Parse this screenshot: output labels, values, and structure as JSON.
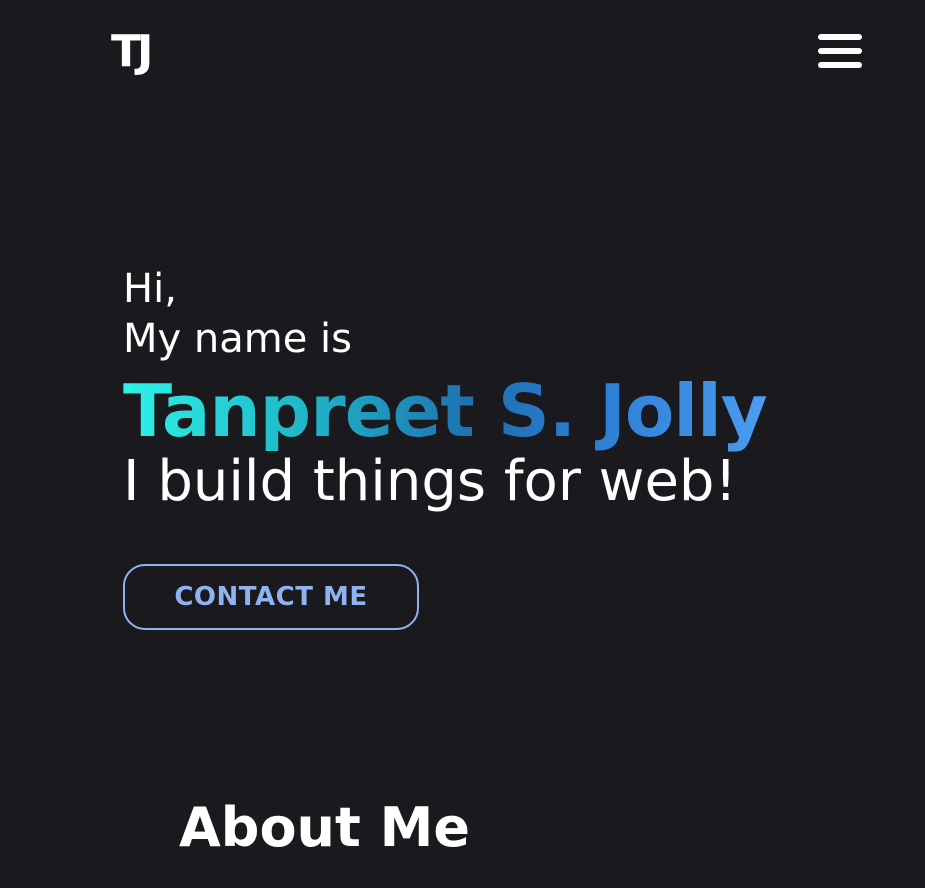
{
  "header": {
    "logo_text": "TJ",
    "menu_icon": "hamburger-menu-icon"
  },
  "hero": {
    "greeting_line1": "Hi,",
    "greeting_line2": "My name is",
    "name": "Tanpreet S. Jolly",
    "tagline": "I build things for web!",
    "contact_label": "CONTACT ME"
  },
  "about": {
    "title": "About Me"
  },
  "colors": {
    "background": "#1a191e",
    "text": "#ffffff",
    "accent_button": "#8fb2f2",
    "name_gradient_start": "#2ef2e8",
    "name_gradient_end": "#4a9df0"
  }
}
